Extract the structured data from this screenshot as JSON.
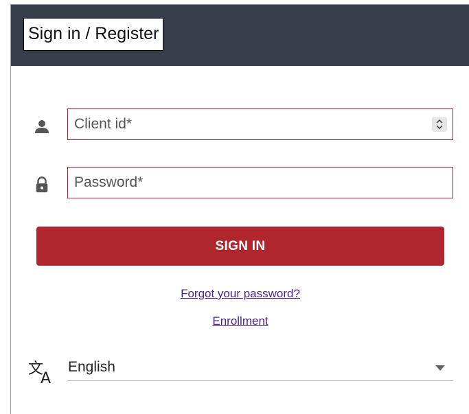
{
  "header": {
    "title": "Sign in / Register"
  },
  "form": {
    "client_id": {
      "placeholder": "Client id*",
      "value": "",
      "icon": "user-icon"
    },
    "password": {
      "placeholder": "Password*",
      "value": "",
      "icon": "lock-icon"
    },
    "signin_label": "SIGN IN"
  },
  "links": {
    "forgot_password": "Forgot your password?",
    "enrollment": "Enrollment"
  },
  "language": {
    "icon": "translate-icon",
    "selected": "English"
  },
  "colors": {
    "header_bg": "#343d48",
    "accent": "#b0262f",
    "link": "#4a1f8a"
  }
}
